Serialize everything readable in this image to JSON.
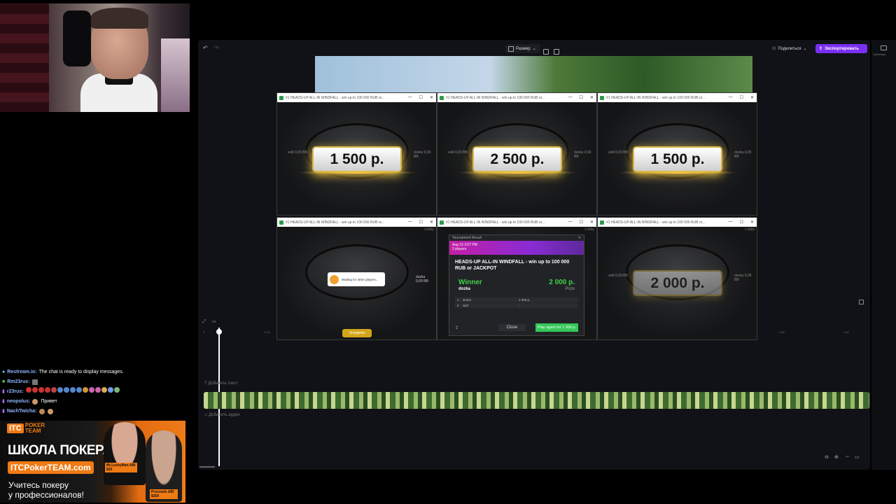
{
  "chat": {
    "lines": [
      {
        "user": "Restream.io:",
        "msg": "The chat is ready to display messages."
      },
      {
        "user": "Rm23rus:",
        "msg": ""
      },
      {
        "user": "r23rus:",
        "msg": ""
      },
      {
        "user": "neopolus:",
        "msg": "Привет"
      },
      {
        "user": "NachTwicha:",
        "msg": ""
      }
    ]
  },
  "ad": {
    "brand_itc": "ITC",
    "brand_line1": "POKER",
    "brand_line2": "TEAM",
    "title": "ШКОЛА ПОКЕРА",
    "url": "ITCPokerTEAM.com",
    "subtitle_line1": "Учитесь покеру",
    "subtitle_line2": "у профессионалов!",
    "tag1": "Mr.LuckyMan ABI $25",
    "tag2": "Proceeds ABI $250"
  },
  "editor": {
    "size_label": "Размер",
    "share_label": "Поделиться",
    "export_label": "Экспортировать",
    "rail_label": "Субтитры",
    "add_text": "Добавить текст",
    "add_audio": "Добавить аудио",
    "ruler": [
      "0",
      "0:10",
      "1:30",
      "1:40"
    ]
  },
  "windows": {
    "title": "#1 HEADS-UP ALL-IN WINDFALL - win up to 100 000 RUB or...",
    "top": [
      {
        "prize": "1 500 р.",
        "left_seat": "widl 0,00 BB",
        "right_seat": "dozka 0,00 BB"
      },
      {
        "prize": "2 500 р.",
        "left_seat": "widl 0,00 BB",
        "right_seat": "dozka 0,00 BB"
      },
      {
        "prize": "1 500 р.",
        "left_seat": "widl 0,00 BB",
        "right_seat": "dozka 0,00 BB"
      }
    ],
    "lobby": "Lobby",
    "waiting": "Waiting for other players...",
    "unregister": "Unregister",
    "right_seat_name": "dozka",
    "right_seat_stack": "0,00 BB",
    "faded_prize": "2 000 р.",
    "faded_left": "widl 0,00 BB",
    "faded_right": "dozka 0,00 BB"
  },
  "dialog": {
    "header": "Tournament Result",
    "date": "Aug 15 3:07 PM",
    "players": "2 players",
    "title": "HEADS-UP ALL-IN WINDFALL - win up to 100 000 RUB or JACKPOT",
    "winner_label": "Winner",
    "winner_amount": "2 000 р.",
    "winner_name": "dozka",
    "prize_label": "Prize",
    "rows": [
      {
        "pos": "1",
        "name": "dozka",
        "amount": "2 000 р."
      },
      {
        "pos": "2",
        "name": "widl",
        "amount": "-"
      }
    ],
    "close": "Close",
    "play_again": "Play again for 1 000 р."
  }
}
